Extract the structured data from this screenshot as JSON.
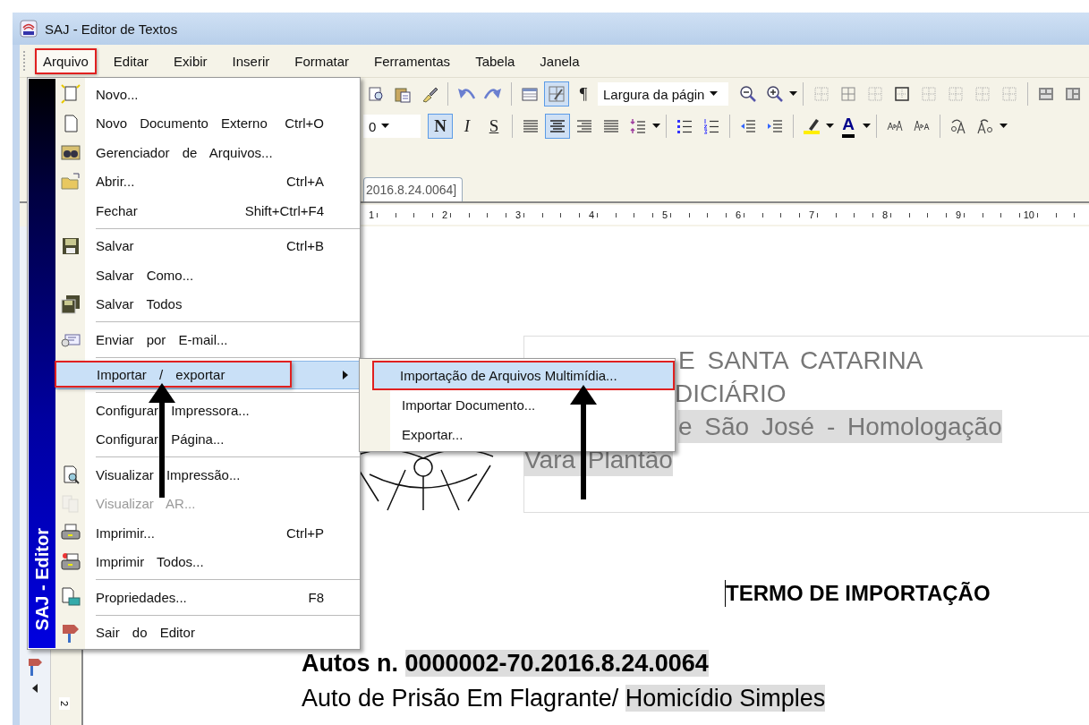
{
  "window": {
    "title": "SAJ - Editor de Textos"
  },
  "menubar": [
    {
      "label": "Arquivo",
      "selected": true,
      "marked": true
    },
    {
      "label": "Editar",
      "selected": false,
      "marked": false
    },
    {
      "label": "Exibir",
      "selected": false,
      "marked": false
    },
    {
      "label": "Inserir",
      "selected": false,
      "marked": false
    },
    {
      "label": "Formatar",
      "selected": false,
      "marked": false
    },
    {
      "label": "Ferramentas",
      "selected": false,
      "marked": false
    },
    {
      "label": "Tabela",
      "selected": false,
      "marked": false
    },
    {
      "label": "Janela",
      "selected": false,
      "marked": false
    }
  ],
  "toolbar_1": [
    {
      "kind": "icon",
      "pressed": false
    },
    {
      "kind": "icon",
      "pressed": false
    },
    {
      "kind": "icon",
      "pressed": false
    },
    {
      "kind": "separator"
    },
    {
      "kind": "icon",
      "pressed": false
    },
    {
      "kind": "icon",
      "pressed": false
    },
    {
      "kind": "separator"
    },
    {
      "kind": "icon",
      "pressed": false
    },
    {
      "kind": "icon",
      "pressed": true
    },
    {
      "kind": "pilcrow",
      "text": "¶",
      "pressed": false
    },
    {
      "kind": "combo",
      "value": "Largura da págin"
    },
    {
      "kind": "icon",
      "pressed": false
    },
    {
      "kind": "icon",
      "pressed": false
    },
    {
      "kind": "caret"
    },
    {
      "kind": "separator"
    },
    {
      "kind": "icon",
      "pressed": false
    },
    {
      "kind": "icon",
      "pressed": false
    },
    {
      "kind": "icon",
      "pressed": false
    },
    {
      "kind": "icon",
      "pressed": false
    },
    {
      "kind": "icon",
      "pressed": false
    },
    {
      "kind": "icon",
      "pressed": false
    },
    {
      "kind": "icon",
      "pressed": false
    },
    {
      "kind": "icon",
      "pressed": false
    },
    {
      "kind": "separator"
    },
    {
      "kind": "icon",
      "pressed": false
    },
    {
      "kind": "icon",
      "pressed": false
    }
  ],
  "toolbar_2": [
    {
      "kind": "combo",
      "value": "0"
    },
    {
      "kind": "bold",
      "text": "N",
      "pressed": true
    },
    {
      "kind": "italic",
      "text": "I",
      "pressed": false
    },
    {
      "kind": "strike",
      "text": "S",
      "pressed": false
    },
    {
      "kind": "separator"
    },
    {
      "kind": "icon",
      "pressed": false
    },
    {
      "kind": "icon",
      "pressed": true
    },
    {
      "kind": "icon",
      "pressed": false
    },
    {
      "kind": "icon",
      "pressed": false
    },
    {
      "kind": "icon",
      "pressed": false
    },
    {
      "kind": "caret"
    },
    {
      "kind": "separator"
    },
    {
      "kind": "icon",
      "pressed": false
    },
    {
      "kind": "icon",
      "pressed": false
    },
    {
      "kind": "separator"
    },
    {
      "kind": "icon",
      "pressed": false
    },
    {
      "kind": "icon",
      "pressed": false
    },
    {
      "kind": "separator"
    },
    {
      "kind": "icon",
      "pressed": false
    },
    {
      "kind": "caret"
    },
    {
      "kind": "fontcolor",
      "text": "A",
      "pressed": false
    },
    {
      "kind": "caret"
    },
    {
      "kind": "separator"
    },
    {
      "kind": "icon",
      "pressed": false
    },
    {
      "kind": "icon",
      "pressed": false
    },
    {
      "kind": "separator"
    },
    {
      "kind": "icon",
      "pressed": false
    },
    {
      "kind": "icon",
      "pressed": false
    },
    {
      "kind": "caret"
    }
  ],
  "document_tab": {
    "label": "2016.8.24.0064]"
  },
  "ruler": {
    "labels": [
      "1",
      "2",
      "3",
      "4",
      "5",
      "6",
      "7",
      "8",
      "9",
      "10"
    ]
  },
  "vertical_ruler": {
    "labels": [
      "2"
    ]
  },
  "document": {
    "header_lines": [
      {
        "text": "E SANTA CATARINA",
        "highlighted": false
      },
      {
        "text": "DICIÁRIO",
        "highlighted": false
      },
      {
        "text": "e São José - Homologação",
        "highlighted": true
      },
      {
        "text": "Vara Plantão",
        "highlighted": true
      }
    ],
    "title": "TERMO DE IMPORTAÇÃO",
    "case_line": [
      {
        "text": "Autos n. ",
        "highlighted": false
      },
      {
        "text": "0000002-70.2016.8.24.0064",
        "highlighted": true
      }
    ],
    "subject_line": [
      {
        "text": "Auto de Prisão Em Flagrante",
        "highlighted": false
      },
      {
        "text": "/ ",
        "highlighted": false
      },
      {
        "text": "Homicídio Simples",
        "highlighted": true
      }
    ]
  },
  "file_menu": {
    "sidebar_label": "SAJ - Editor",
    "items": [
      {
        "kind": "item",
        "label": "Novo...",
        "disabled": false,
        "selected": false,
        "submenu": false,
        "marked": false
      },
      {
        "kind": "item",
        "label": "Novo Documento Externo",
        "shortcut": "Ctrl+O",
        "disabled": false,
        "selected": false,
        "submenu": false,
        "marked": false
      },
      {
        "kind": "item",
        "label": "Gerenciador de Arquivos...",
        "disabled": false,
        "selected": false,
        "submenu": false,
        "marked": false
      },
      {
        "kind": "item",
        "label": "Abrir...",
        "shortcut": "Ctrl+A",
        "disabled": false,
        "selected": false,
        "submenu": false,
        "marked": false
      },
      {
        "kind": "item",
        "label": "Fechar",
        "shortcut": "Shift+Ctrl+F4",
        "disabled": false,
        "selected": false,
        "submenu": false,
        "marked": false
      },
      {
        "kind": "separator"
      },
      {
        "kind": "item",
        "label": "Salvar",
        "shortcut": "Ctrl+B",
        "disabled": false,
        "selected": false,
        "submenu": false,
        "marked": false
      },
      {
        "kind": "item",
        "label": "Salvar Como...",
        "disabled": false,
        "selected": false,
        "submenu": false,
        "marked": false
      },
      {
        "kind": "item",
        "label": "Salvar Todos",
        "disabled": false,
        "selected": false,
        "submenu": false,
        "marked": false
      },
      {
        "kind": "separator"
      },
      {
        "kind": "item",
        "label": "Enviar por E-mail...",
        "disabled": false,
        "selected": false,
        "submenu": false,
        "marked": false
      },
      {
        "kind": "separator"
      },
      {
        "kind": "item",
        "label": "Importar / exportar",
        "disabled": false,
        "selected": true,
        "submenu": true,
        "marked": true
      },
      {
        "kind": "separator"
      },
      {
        "kind": "item",
        "label": "Configurar Impressora...",
        "disabled": false,
        "selected": false,
        "submenu": false,
        "marked": false
      },
      {
        "kind": "item",
        "label": "Configurar Página...",
        "disabled": false,
        "selected": false,
        "submenu": false,
        "marked": false
      },
      {
        "kind": "separator"
      },
      {
        "kind": "item",
        "label": "Visualizar Impressão...",
        "disabled": false,
        "selected": false,
        "submenu": false,
        "marked": false
      },
      {
        "kind": "item",
        "label": "Visualizar AR...",
        "disabled": true,
        "selected": false,
        "submenu": false,
        "marked": false
      },
      {
        "kind": "item",
        "label": "Imprimir...",
        "shortcut": "Ctrl+P",
        "disabled": false,
        "selected": false,
        "submenu": false,
        "marked": false
      },
      {
        "kind": "item",
        "label": "Imprimir Todos...",
        "disabled": false,
        "selected": false,
        "submenu": false,
        "marked": false
      },
      {
        "kind": "separator"
      },
      {
        "kind": "item",
        "label": "Propriedades...",
        "shortcut": "F8",
        "disabled": false,
        "selected": false,
        "submenu": false,
        "marked": false
      },
      {
        "kind": "separator"
      },
      {
        "kind": "item",
        "label": "Sair do Editor",
        "disabled": false,
        "selected": false,
        "submenu": false,
        "marked": false
      }
    ]
  },
  "submenu": {
    "items": [
      {
        "label": "Importação de Arquivos Multimídia...",
        "selected": true,
        "marked": true
      },
      {
        "label": "Importar Documento...",
        "selected": false,
        "marked": false
      },
      {
        "label": "Exportar...",
        "selected": false,
        "marked": false
      }
    ]
  }
}
